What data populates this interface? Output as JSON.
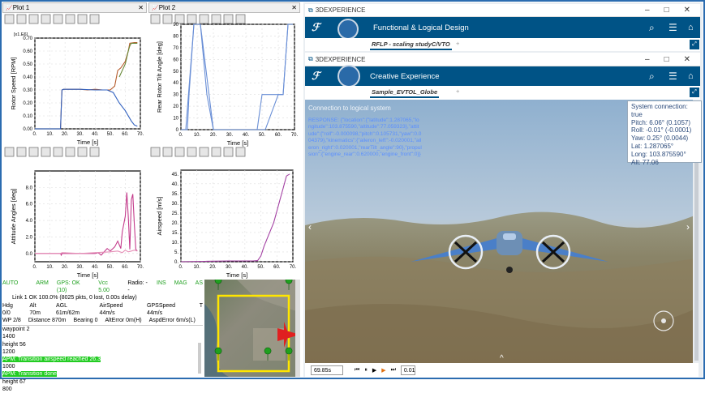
{
  "plots": {
    "plot1": {
      "title": "Plot 1"
    },
    "plot2": {
      "title": "Plot 2"
    }
  },
  "chart_data": [
    {
      "type": "line",
      "ylabel": "Rotor Speed [RPM]",
      "xlabel": "Time [s]",
      "multiplier": "[x1.E6]",
      "ylim": [
        0,
        0.7
      ],
      "xlim": [
        0,
        70
      ],
      "yticks": [
        "0.70",
        "0.60",
        "0.50",
        "0.40",
        "0.30",
        "0.20",
        "0.10",
        "0.00"
      ],
      "xticks": [
        "0.",
        "10.",
        "20.",
        "30.",
        "40.",
        "50.",
        "60.",
        "70."
      ],
      "series": [
        {
          "color": "#b45a2a",
          "x": [
            0,
            17,
            17.5,
            18,
            19,
            30,
            35,
            40,
            45,
            50,
            53,
            55,
            57,
            60,
            62,
            63,
            66,
            68
          ],
          "y": [
            0,
            0,
            0.16,
            0.3,
            0.305,
            0.305,
            0.3,
            0.305,
            0.3,
            0.3,
            0.33,
            0.45,
            0.47,
            0.52,
            0.6,
            0.66,
            0.665,
            0.665
          ]
        },
        {
          "color": "#2e5fbf",
          "x": [
            0,
            17,
            17.5,
            18,
            19,
            30,
            40,
            48,
            52,
            54,
            56,
            58,
            60,
            62,
            64,
            66,
            68
          ],
          "y": [
            0,
            0,
            0.16,
            0.3,
            0.305,
            0.305,
            0.3,
            0.3,
            0.28,
            0.24,
            0.2,
            0.17,
            0.14,
            0.1,
            0.06,
            0.03,
            0.02
          ]
        },
        {
          "color": "#6a8a3a",
          "x": [
            56,
            58,
            60,
            61,
            62,
            63,
            64,
            66,
            68
          ],
          "y": [
            0.4,
            0.45,
            0.5,
            0.55,
            0.6,
            0.64,
            0.66,
            0.66,
            0.66
          ]
        }
      ]
    },
    {
      "type": "line",
      "ylabel": "Rear Rotor Tilt Angle [deg]",
      "xlabel": "Time [s]",
      "ylim": [
        0,
        90
      ],
      "xlim": [
        0,
        70
      ],
      "yticks": [
        "90",
        "80",
        "70",
        "60",
        "50",
        "40",
        "30",
        "20",
        "10",
        "0"
      ],
      "xticks": [
        "0.",
        "10.",
        "20.",
        "30.",
        "40.",
        "50.",
        "60.",
        "70."
      ],
      "series": [
        {
          "color": "#6a8fd6",
          "x": [
            0,
            3,
            8,
            12,
            20,
            24,
            28,
            30,
            45,
            47,
            52,
            60,
            63,
            66,
            69
          ],
          "y": [
            0,
            0,
            90,
            90,
            0,
            0,
            0,
            0,
            0,
            0,
            0,
            30,
            30,
            90,
            90
          ]
        },
        {
          "color": "#6a8fd6",
          "x": [
            3,
            4,
            5,
            8,
            12,
            16,
            20
          ],
          "y": [
            0,
            0,
            30,
            90,
            90,
            30,
            0
          ]
        },
        {
          "color": "#6a8fd6",
          "x": [
            47,
            50,
            52,
            60,
            63,
            66,
            69
          ],
          "y": [
            0,
            30,
            30,
            30,
            30,
            90,
            90
          ]
        }
      ]
    },
    {
      "type": "line",
      "ylabel": "Attitude Angles [deg]",
      "xlabel": "Time [s]",
      "ylim": [
        -1,
        10
      ],
      "xlim": [
        0,
        70
      ],
      "yticks": [
        "8.0",
        "6.0",
        "4.0",
        "2.0",
        "0.0"
      ],
      "xticks": [
        "0.",
        "10.",
        "20.",
        "30.",
        "40.",
        "50.",
        "60.",
        "70."
      ],
      "series": [
        {
          "color": "#c43c8c",
          "x": [
            0,
            17,
            17.5,
            18,
            30,
            40,
            42,
            44,
            46,
            48,
            50,
            53,
            55,
            57,
            58,
            60,
            61,
            62,
            63,
            64,
            65,
            66,
            67,
            68
          ],
          "y": [
            0,
            0,
            -0.2,
            0,
            0,
            0,
            0.1,
            -0.2,
            0.2,
            0.6,
            0.3,
            0.8,
            1.5,
            0.6,
            2.6,
            4.5,
            7.4,
            4.5,
            0.5,
            6.5,
            7.2,
            3.5,
            0.5,
            0.3
          ]
        },
        {
          "color": "#e58fb6",
          "x": [
            0,
            17,
            18,
            30,
            40,
            50,
            55,
            58,
            60,
            62,
            64,
            66,
            68
          ],
          "y": [
            0,
            0,
            0.1,
            0,
            0.1,
            0.2,
            0.3,
            0.1,
            0.4,
            0.2,
            0.3,
            0.4,
            0.3
          ]
        }
      ]
    },
    {
      "type": "line",
      "ylabel": "Airspeed [m/s]",
      "xlabel": "Time [s]",
      "ylim": [
        0,
        47
      ],
      "xlim": [
        0,
        70
      ],
      "yticks": [
        "45.",
        "40.",
        "35.",
        "30.",
        "25.",
        "20.",
        "15.",
        "10.",
        "5.",
        "0."
      ],
      "xticks": [
        "0.",
        "10.",
        "20.",
        "30.",
        "40.",
        "50.",
        "60.",
        "70."
      ],
      "series": [
        {
          "color": "#a340a3",
          "x": [
            0,
            15,
            20,
            30,
            40,
            45,
            48,
            50,
            52,
            55,
            58,
            60,
            62,
            64,
            66,
            68
          ],
          "y": [
            0,
            0.2,
            0.3,
            0.4,
            0.4,
            0.4,
            0.6,
            3,
            8,
            14,
            20,
            26,
            32,
            38,
            44,
            45
          ]
        }
      ]
    }
  ],
  "status": {
    "modes": [
      "AUTO",
      "ARM",
      "GPS: OK (10)",
      "Vcc 5.00",
      "Radio: --",
      "INS",
      "MAG",
      "AS"
    ],
    "link": "Link 1 OK 100.0% (8025 pkts, 0 lost, 0.00s delay)",
    "row1": [
      "Hdg 0/0",
      "Alt 70m",
      "AGL 61m/62m",
      "AirSpeed 44m/s",
      "GPSSpeed 44m/s",
      "T"
    ],
    "row2": [
      "WP 2/8",
      "Distance 870m",
      "Bearing 0",
      "AltError 0m(H)",
      "AspdError 6m/s(L)"
    ],
    "log": [
      "waypoint 2",
      "1400",
      "height 56",
      "1200",
      "APM: Transition airspeed reached 26.3",
      "1000",
      "APM: Transition done",
      "height 67",
      "800"
    ]
  },
  "win1": {
    "app": "3DEXPERIENCE",
    "title": "Functional & Logical Design",
    "tab": "RFLP - scaling studyC/VTO",
    "plus": "+"
  },
  "win2": {
    "app": "3DEXPERIENCE",
    "title": "Creative Experience",
    "tab": "Sample_EVTOL_Globe",
    "plus": "+"
  },
  "window_controls": [
    "–",
    "□",
    "✕"
  ],
  "viewport": {
    "connection": "Connection to logical system",
    "response": "RESPONSE: {\"location\":{\"latitude\":1.287065,\"longitude\":103.875590,\"altitude\":77.059323},\"attitude\":{\"roll\":-0.000098,\"pitch\":0.105731,\"yaw\":0.004379},\"kinematics\":{\"aileron_left\":-0.020001,\"aileron_right\":0.020001,\"rearTilt_angle\":90},\"propulsion\":{\"engine_rear\":0.620000,\"engine_front\":0}}"
  },
  "info": {
    "lines": [
      "System connection: true",
      "Pitch:  6.06° (0.1057)",
      "Roll:  -0.01° (-0.0001)",
      "Yaw:  0.25° (0.0044)",
      "Lat:  1.287065°",
      "Long:  103.875590°",
      "Alt: 77.06"
    ]
  },
  "player": {
    "time": "69.85s",
    "speed": "0.01"
  },
  "colors": {
    "ds_blue": "#005386",
    "frame": "#2b6cb0",
    "green_hl": "#22cc22"
  }
}
